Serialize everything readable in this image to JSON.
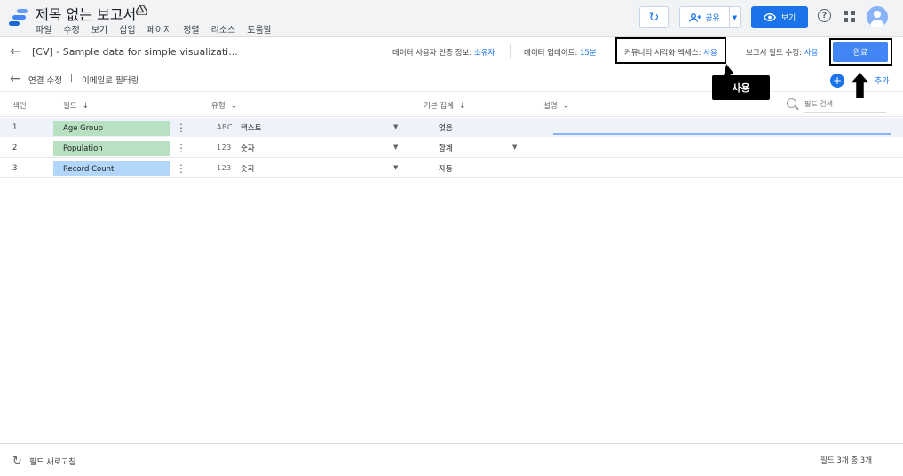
{
  "app": {
    "doc_title": "제목 없는 보고서",
    "menu": [
      "파일",
      "수정",
      "보기",
      "삽입",
      "페이지",
      "정렬",
      "리소스",
      "도움말"
    ],
    "share_label": "공유",
    "view_label": "보기",
    "colors": {
      "accent": "#1a73e8",
      "done": "#4285f4",
      "chip_green": "#b7e1c1",
      "chip_blue": "#b3d7fb"
    }
  },
  "datasource": {
    "name": "[CV] - Sample data for simple visualizati...",
    "credentials_label": "데이터 사용자 인증 정보:",
    "credentials_value": "소유자",
    "freshness_label": "데이터 업데이트:",
    "freshness_value": "15분",
    "community_label": "커뮤니티 시각화 액세스:",
    "community_value": "사용",
    "field_edit_label": "보고서 필드 수정:",
    "field_edit_value": "사용",
    "done_label": "완료"
  },
  "callout": {
    "text": "사용"
  },
  "subbar": {
    "connection_edit": "연결 수정",
    "separator": "|",
    "email_filter": "이메일로 필터링",
    "add_field_suffix": "추가"
  },
  "table": {
    "headers": {
      "index": "색인",
      "field": "필드",
      "type": "유형",
      "aggregation": "기본 집계",
      "description": "설명"
    },
    "search_placeholder": "필드 검색",
    "rows": [
      {
        "index": "1",
        "field": "Age Group",
        "type_code": "ABC",
        "type_name": "텍스트",
        "aggregation": "없음"
      },
      {
        "index": "2",
        "field": "Population",
        "type_code": "123",
        "type_name": "숫자",
        "aggregation": "합계"
      },
      {
        "index": "3",
        "field": "Record Count",
        "type_code": "123",
        "type_name": "숫자",
        "aggregation": "자동"
      }
    ]
  },
  "footer": {
    "refresh_label": "필드 새로고침",
    "count_label": "필드 3개 중 3개"
  }
}
